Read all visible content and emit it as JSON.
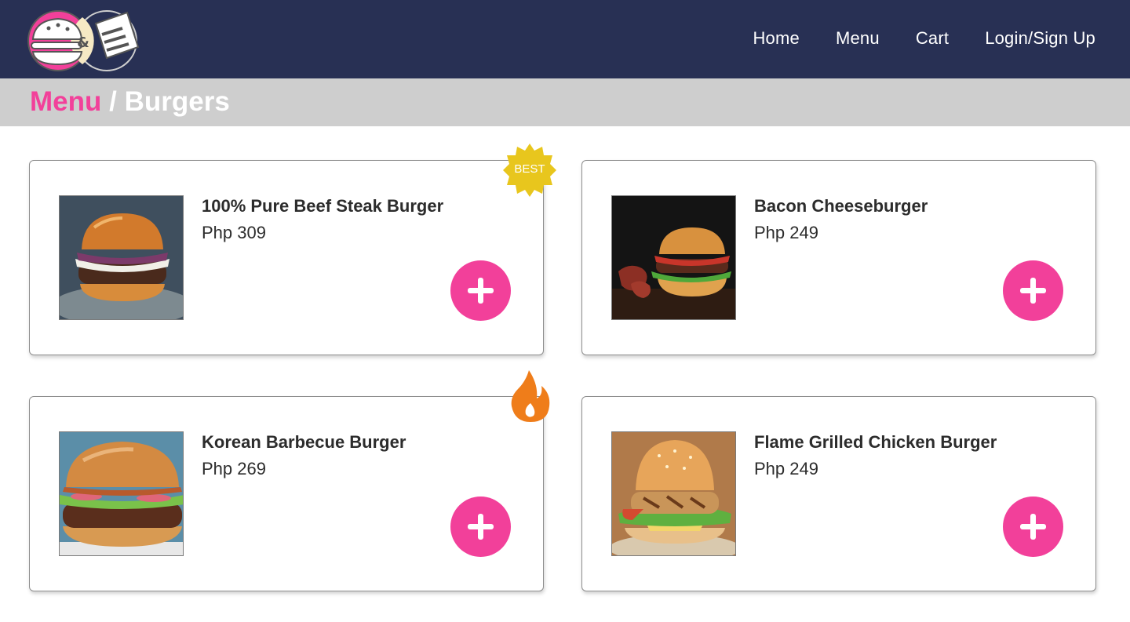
{
  "nav": {
    "links": [
      "Home",
      "Menu",
      "Cart",
      "Login/Sign Up"
    ],
    "logo_icon": "burger-and-menu-logo"
  },
  "breadcrumb": {
    "parent": "Menu",
    "separator": " / ",
    "current": "Burgers"
  },
  "products": [
    {
      "name": "100% Pure Beef Steak Burger",
      "price": "Php 309",
      "badge": "BEST",
      "image_icon": "beef-burger-photo"
    },
    {
      "name": "Bacon Cheeseburger",
      "price": "Php 249",
      "image_icon": "bacon-burger-photo"
    },
    {
      "name": "Korean Barbecue Burger",
      "price": "Php 269",
      "badge_icon": "flame-icon",
      "image_icon": "korean-bbq-burger-photo"
    },
    {
      "name": "Flame Grilled Chicken Burger",
      "price": "Php 249",
      "image_icon": "chicken-burger-photo"
    }
  ],
  "colors": {
    "navbar": "#283054",
    "accent": "#f2409a",
    "crumb_bar": "#cecece",
    "best_badge": "#e8c61d",
    "flame": "#ef7d1a"
  }
}
